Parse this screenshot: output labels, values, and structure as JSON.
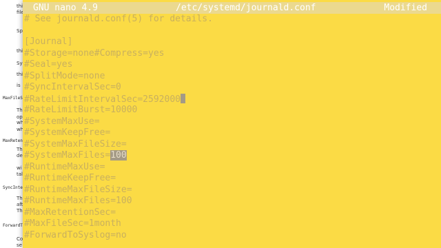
{
  "background_window": {
    "lines": [
      "thi",
      "file",
      "",
      "Sp",
      "thi",
      "",
      "Sync",
      "thi",
      "is",
      "",
      "MaxFileS",
      "",
      "Th",
      "op",
      "wh",
      "wh",
      "",
      "MaxReten",
      "",
      "Th",
      "de",
      "wi",
      "tal",
      "",
      "SyncInte",
      "",
      "Th",
      "aft",
      "Th",
      "",
      "ForwardT",
      "",
      "Co",
      "se",
      "for",
      "\"-",
      "Th",
      "sp"
    ]
  },
  "terminal": {
    "app_name": "GNU nano 4.9",
    "file_path": "/etc/systemd/journald.conf",
    "status": "Modified",
    "lines": [
      "# See journald.conf(5) for details.",
      "",
      "[Journal]",
      "#Storage=none#Compress=yes",
      "#Seal=yes",
      "#SplitMode=none",
      "#SyncIntervalSec=0",
      "#RateLimitIntervalSec=2592000",
      "#RateLimitBurst=10000",
      "#SystemMaxUse=",
      "#SystemKeepFree=",
      "#SystemMaxFileSize=",
      "#SystemMaxFiles=",
      "#RuntimeMaxUse=",
      "#RuntimeKeepFree=",
      "#RuntimeMaxFileSize=",
      "#RuntimeMaxFiles=100",
      "#MaxRetentionSec=",
      "#MaxFileSec=1month",
      "#ForwardToSyslog=no"
    ],
    "selected_text": "100",
    "selected_line_index": 12
  },
  "colors": {
    "terminal_bg": "#fbdb45",
    "text": "#c9b05e",
    "titlebar_bg": "#ebd98f",
    "selection_bg": "#a49a86"
  }
}
